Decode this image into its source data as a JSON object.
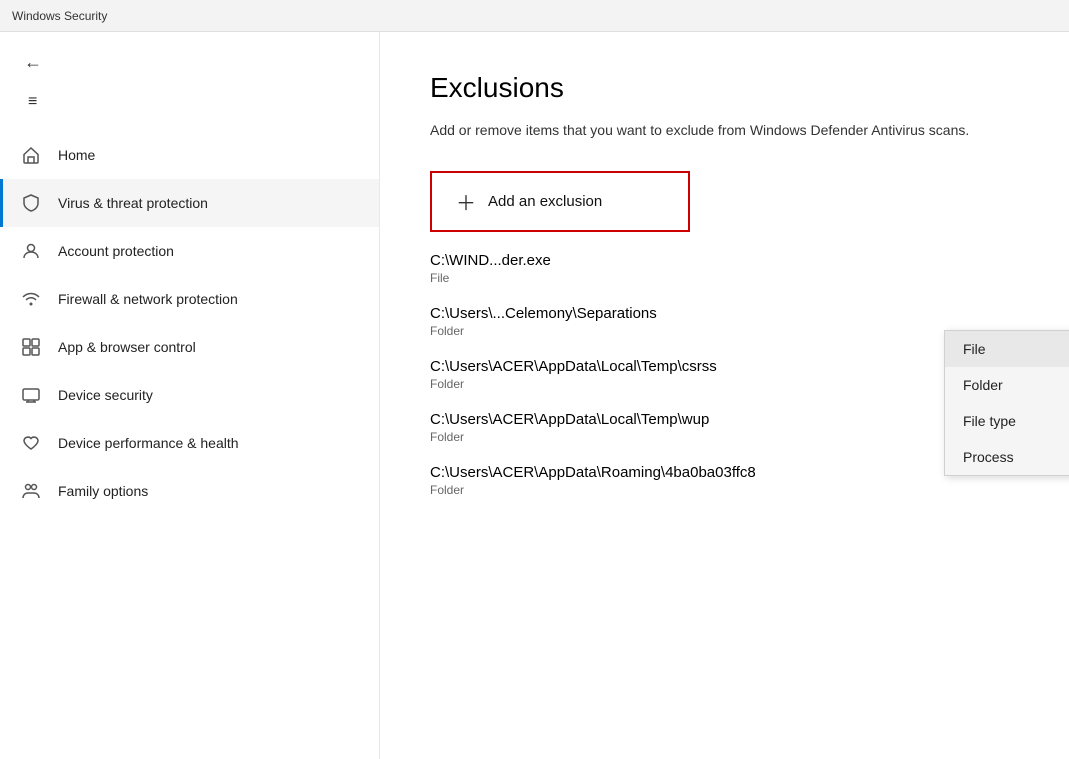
{
  "titlebar": {
    "title": "Windows Security"
  },
  "sidebar": {
    "back_icon": "←",
    "hamburger_icon": "≡",
    "items": [
      {
        "id": "home",
        "label": "Home",
        "icon": "home",
        "active": false
      },
      {
        "id": "virus",
        "label": "Virus & threat protection",
        "icon": "shield",
        "active": true
      },
      {
        "id": "account",
        "label": "Account protection",
        "icon": "person",
        "active": false
      },
      {
        "id": "firewall",
        "label": "Firewall & network protection",
        "icon": "wifi",
        "active": false
      },
      {
        "id": "app",
        "label": "App & browser control",
        "icon": "app",
        "active": false
      },
      {
        "id": "device-security",
        "label": "Device security",
        "icon": "device",
        "active": false
      },
      {
        "id": "device-health",
        "label": "Device performance & health",
        "icon": "heart",
        "active": false
      },
      {
        "id": "family",
        "label": "Family options",
        "icon": "family",
        "active": false
      }
    ]
  },
  "content": {
    "page_title": "Exclusions",
    "description": "Add or remove items that you want to exclude from Windows Defender Antivirus scans.",
    "add_button_label": "Add an exclusion",
    "exclusions": [
      {
        "path": "C:\\WIND...der.exe",
        "type": "File"
      },
      {
        "path": "C:\\Users\\...Celemony\\Separations",
        "type": "Folder"
      },
      {
        "path": "C:\\Users\\ACER\\AppData\\Local\\Temp\\csrss",
        "type": "Folder"
      },
      {
        "path": "C:\\Users\\ACER\\AppData\\Local\\Temp\\wup",
        "type": "Folder"
      },
      {
        "path": "C:\\Users\\ACER\\AppData\\Roaming\\4ba0ba03ffc8",
        "type": "Folder"
      }
    ]
  },
  "dropdown": {
    "items": [
      {
        "id": "file",
        "label": "File",
        "selected": true
      },
      {
        "id": "folder",
        "label": "Folder",
        "selected": false
      },
      {
        "id": "file-type",
        "label": "File type",
        "selected": false
      },
      {
        "id": "process",
        "label": "Process",
        "selected": false
      }
    ]
  }
}
